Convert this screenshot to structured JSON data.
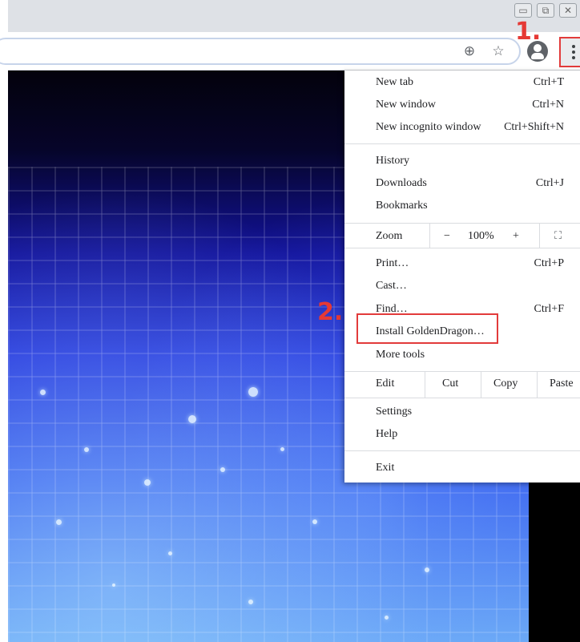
{
  "toolbar": {
    "zoom_icon": "⊕",
    "star_icon": "☆"
  },
  "steps": {
    "step1": "1.",
    "step2": "2."
  },
  "menu": {
    "new_tab": {
      "label": "New tab",
      "shortcut": "Ctrl+T"
    },
    "new_window": {
      "label": "New window",
      "shortcut": "Ctrl+N"
    },
    "new_incognito": {
      "label": "New incognito window",
      "shortcut": "Ctrl+Shift+N"
    },
    "history": {
      "label": "History"
    },
    "downloads": {
      "label": "Downloads",
      "shortcut": "Ctrl+J"
    },
    "bookmarks": {
      "label": "Bookmarks"
    },
    "zoom": {
      "label": "Zoom",
      "minus": "−",
      "level": "100%",
      "plus": "+",
      "fullscreen": "⛶"
    },
    "print": {
      "label": "Print…",
      "shortcut": "Ctrl+P"
    },
    "cast": {
      "label": "Cast…"
    },
    "find": {
      "label": "Find…",
      "shortcut": "Ctrl+F"
    },
    "install": {
      "label": "Install GoldenDragon…"
    },
    "more_tools": {
      "label": "More tools"
    },
    "edit": {
      "label": "Edit",
      "cut": "Cut",
      "copy": "Copy",
      "paste": "Paste"
    },
    "settings": {
      "label": "Settings"
    },
    "help": {
      "label": "Help"
    },
    "exit": {
      "label": "Exit"
    }
  },
  "colors": {
    "annotation": "#e23b3b",
    "step_text": "#e53935"
  }
}
